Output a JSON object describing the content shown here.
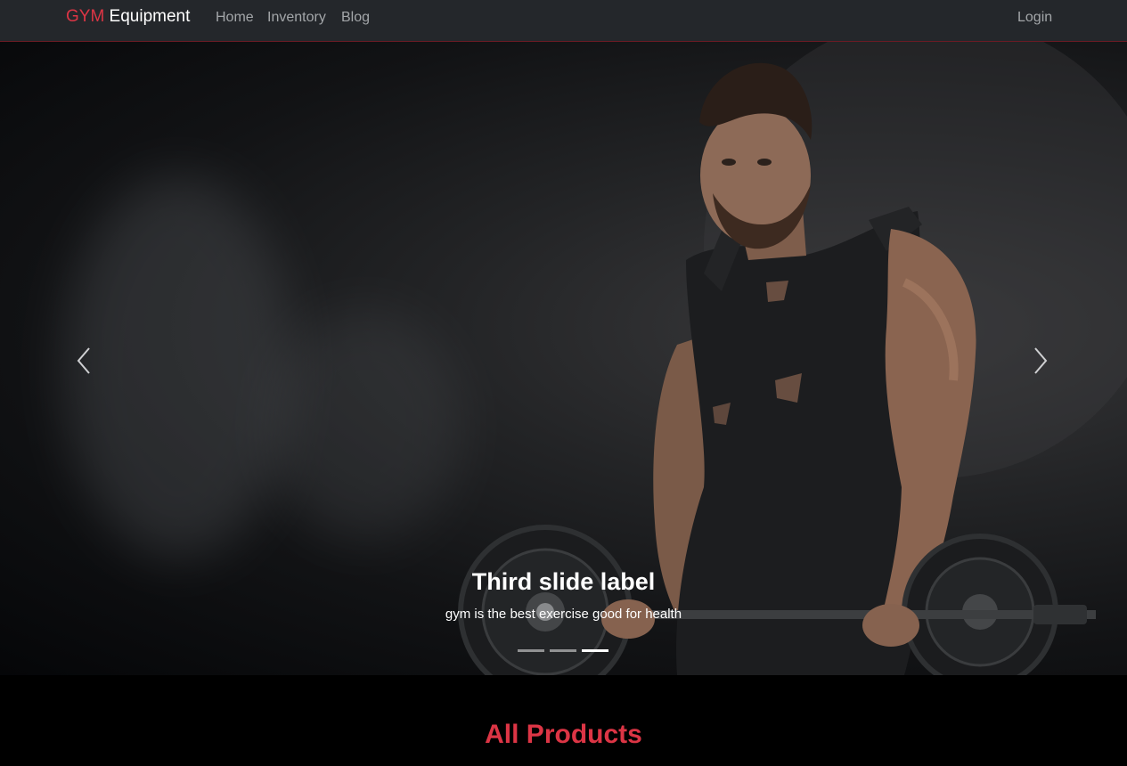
{
  "navbar": {
    "brand_part1": "GYM",
    "brand_part2": " Equipment",
    "links": [
      "Home",
      "Inventory",
      "Blog"
    ],
    "login": "Login"
  },
  "carousel": {
    "caption_title": "Third slide label",
    "caption_text": "gym is the best exercise good for health",
    "indicator_count": 3,
    "active_index": 2,
    "prev_icon": "chevron-left-icon",
    "next_icon": "chevron-right-icon"
  },
  "products": {
    "title": "All Products"
  },
  "colors": {
    "accent": "#dc3545",
    "navbar_bg": "#24272b",
    "page_bg": "#000000"
  }
}
